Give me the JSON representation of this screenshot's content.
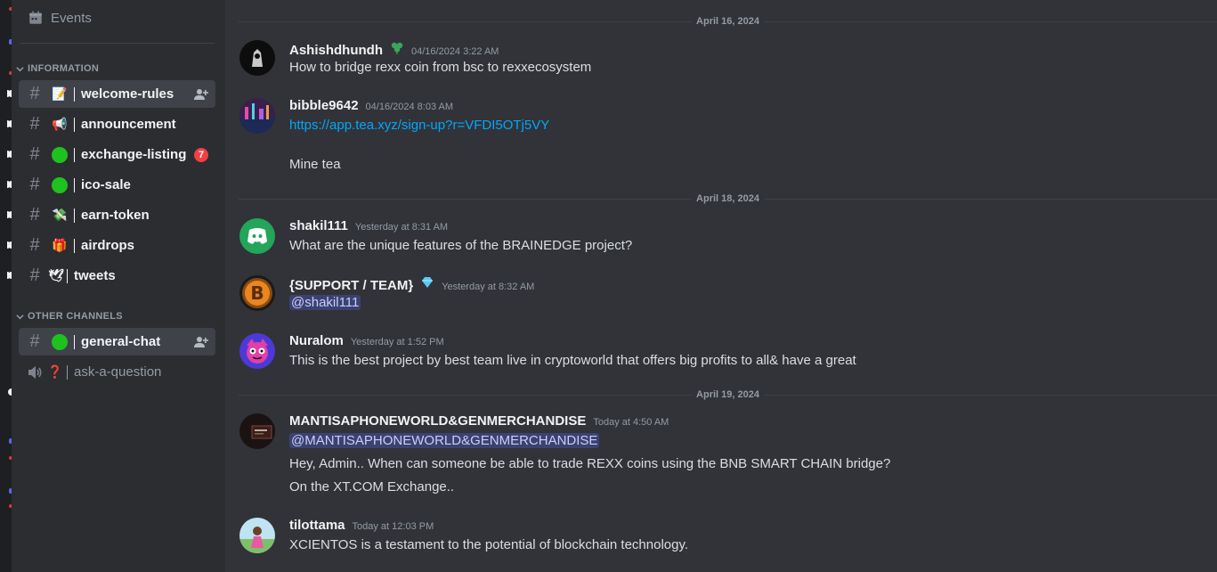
{
  "sidebar": {
    "events_label": "Events",
    "categories": [
      {
        "label": "INFORMATION"
      },
      {
        "label": "OTHER CHANNELS"
      }
    ],
    "channels": [
      {
        "emoji": "📝",
        "name": "welcome-rules"
      },
      {
        "emoji": "📢",
        "name": "announcement"
      },
      {
        "emoji": "",
        "name": "exchange-listing",
        "badge": "7"
      },
      {
        "emoji": "",
        "name": "ico-sale"
      },
      {
        "emoji": "💸",
        "name": "earn-token"
      },
      {
        "emoji": "🎁",
        "name": "airdrops"
      },
      {
        "emoji": "🕊",
        "name": "tweets"
      },
      {
        "emoji": "",
        "name": "general-chat"
      },
      {
        "emoji": "❓",
        "name": "ask-a-question"
      }
    ]
  },
  "chat": {
    "dates": [
      "April 16, 2024",
      "April 18, 2024",
      "April 19, 2024"
    ],
    "messages": [
      {
        "user": "Ashishdhundh",
        "time": "04/16/2024 3:22 AM",
        "lines": [
          "How to bridge rexx coin from bsc to rexxecosystem"
        ]
      },
      {
        "user": "bibble9642",
        "time": "04/16/2024 8:03 AM",
        "link": "https://app.tea.xyz/sign-up?r=VFDI5OTj5VY",
        "lines": [
          "Mine tea"
        ]
      },
      {
        "user": "shakil111",
        "time": "Yesterday at 8:31 AM",
        "lines": [
          "What are the unique features of the BRAINEDGE project?"
        ]
      },
      {
        "user": "{SUPPORT / TEAM}",
        "time": "Yesterday at 8:32 AM",
        "mention": "@shakil111"
      },
      {
        "user": "Nuralom",
        "time": "Yesterday at 1:52 PM",
        "lines": [
          "This is the best project by best team live in cryptoworld that offers big profits to all& have a great"
        ]
      },
      {
        "user": "MANTISAPHONEWORLD&GENMERCHANDISE",
        "time": "Today at 4:50 AM",
        "mention": "@MANTISAPHONEWORLD&GENMERCHANDISE",
        "lines": [
          "Hey, Admin.. When can someone be able to trade REXX coins using the BNB SMART CHAIN bridge?",
          "On the XT.COM Exchange.."
        ]
      },
      {
        "user": "tilottama",
        "time": "Today at 12:03 PM",
        "lines": [
          "XCIENTOS is a testament to the potential of blockchain technology."
        ]
      }
    ]
  },
  "colors": {
    "background": "#313338",
    "sidebar": "#2b2d31",
    "link": "#00a8fc",
    "mention_bg": "#3c4270",
    "badge": "#f23f43",
    "online_green": "#1ec21e"
  }
}
